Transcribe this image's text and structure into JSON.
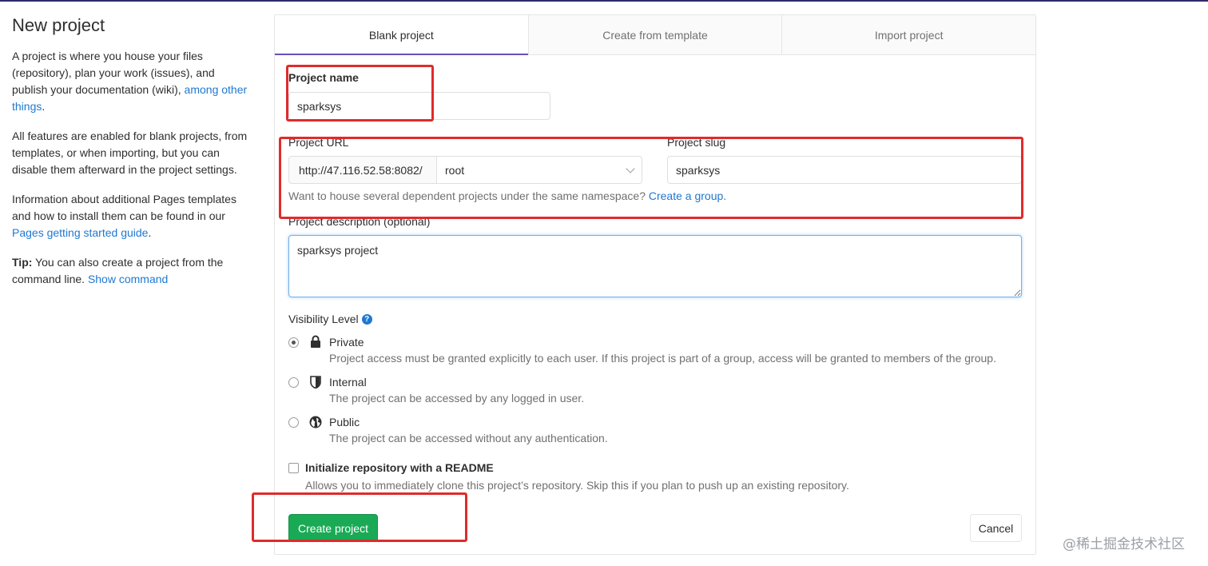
{
  "sidebar": {
    "title": "New project",
    "para1_text": "A project is where you house your files (repository), plan your work (issues), and publish your documentation (wiki), ",
    "para1_link": "among other things",
    "para1_end": ".",
    "para2": "All features are enabled for blank projects, from templates, or when importing, but you can disable them afterward in the project settings.",
    "para3_text": "Information about additional Pages templates and how to install them can be found in our ",
    "para3_link": "Pages getting started guide",
    "para3_end": ".",
    "tip_label": "Tip:",
    "tip_text": " You can also create a project from the command line. ",
    "tip_link": "Show command"
  },
  "tabs": [
    {
      "label": "Blank project",
      "active": true
    },
    {
      "label": "Create from template",
      "active": false
    },
    {
      "label": "Import project",
      "active": false
    }
  ],
  "form": {
    "project_name_label": "Project name",
    "project_name_value": "sparksys",
    "project_url_label": "Project URL",
    "url_prefix": "http://47.116.52.58:8082/",
    "namespace_value": "root",
    "project_slug_label": "Project slug",
    "project_slug_value": "sparksys",
    "namespace_help": "Want to house several dependent projects under the same namespace? ",
    "namespace_help_link": "Create a group.",
    "description_label": "Project description (optional)",
    "description_value": "sparksys project",
    "visibility_label": "Visibility Level",
    "visibility_help_icon": "?",
    "visibility_options": [
      {
        "title": "Private",
        "desc": "Project access must be granted explicitly to each user. If this project is part of a group, access will be granted to members of the group.",
        "icon": "lock-icon",
        "checked": true
      },
      {
        "title": "Internal",
        "desc": "The project can be accessed by any logged in user.",
        "icon": "shield-icon",
        "checked": false
      },
      {
        "title": "Public",
        "desc": "The project can be accessed without any authentication.",
        "icon": "globe-icon",
        "checked": false
      }
    ],
    "readme_label": "Initialize repository with a README",
    "readme_desc": "Allows you to immediately clone this project’s repository. Skip this if you plan to push up an existing repository.",
    "readme_checked": false,
    "create_button": "Create project",
    "cancel_button": "Cancel"
  },
  "watermark": "@稀土掘金技术社区",
  "colors": {
    "accent": "#6b4fbb",
    "link": "#1f78d1",
    "create_button": "#1aaa55",
    "annotation_red": "#e02b2b"
  }
}
